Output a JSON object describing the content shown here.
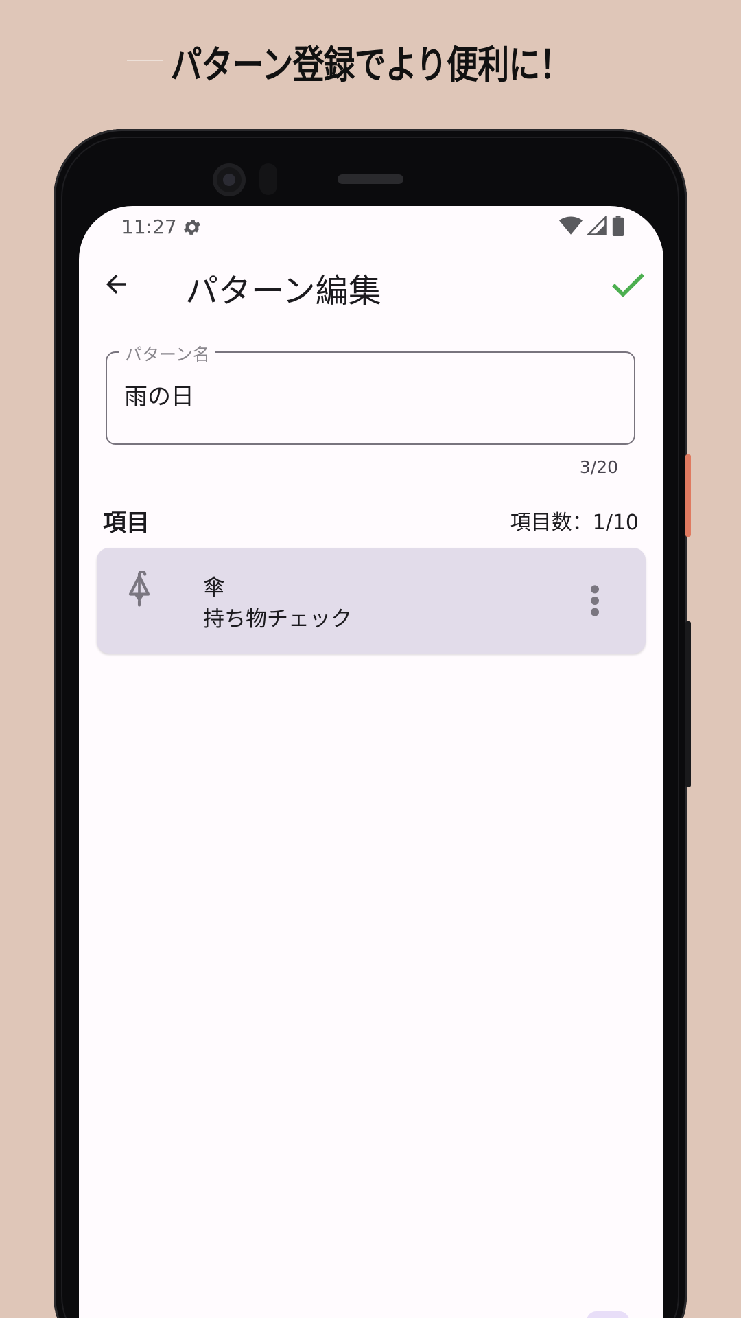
{
  "promo": {
    "title": "パターン登録でより便利に！"
  },
  "status_bar": {
    "time": "11:27",
    "icons": [
      "gear-icon",
      "wifi-icon",
      "signal-icon",
      "battery-icon"
    ]
  },
  "app_bar": {
    "back_icon": "arrow-back-icon",
    "title": "パターン編集",
    "confirm_icon": "check-icon",
    "confirm_color": "#4caf50"
  },
  "pattern_field": {
    "label": "パターン名",
    "value": "雨の日",
    "counter": "3/20"
  },
  "items_section": {
    "title": "項目",
    "count": "項目数：1/10"
  },
  "items": [
    {
      "icon": "umbrella-icon",
      "name": "傘",
      "category": "持ち物チェック",
      "menu_icon": "more-vert-icon"
    }
  ],
  "colors": {
    "background": "#dfc6b8",
    "screen": "#fffbfe",
    "card": "#e2dcea",
    "accent_check": "#4caf50"
  }
}
